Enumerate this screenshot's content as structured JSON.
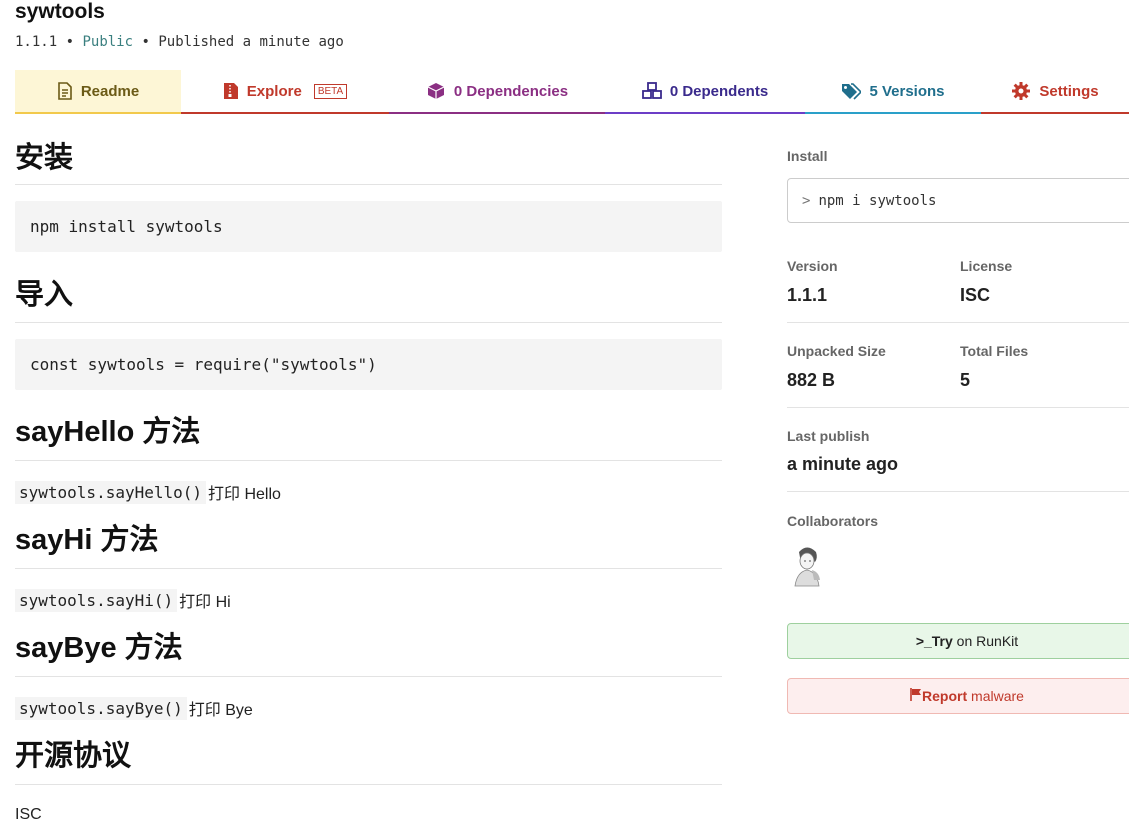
{
  "package": {
    "name": "sywtools",
    "version": "1.1.1",
    "visibility": "Public",
    "published": "Published a minute ago",
    "separator": "•"
  },
  "tabs": [
    {
      "label": "Readme",
      "icon": "readme-icon"
    },
    {
      "label": "Explore",
      "badge": "BETA",
      "icon": "explore-icon"
    },
    {
      "label": "0 Dependencies",
      "icon": "box-icon"
    },
    {
      "label": "0 Dependents",
      "icon": "boxes-icon"
    },
    {
      "label": "5 Versions",
      "icon": "tags-icon"
    },
    {
      "label": "Settings",
      "icon": "gear-icon"
    }
  ],
  "readme": {
    "sections": [
      {
        "heading": "安装",
        "code": "npm install sywtools"
      },
      {
        "heading": "导入",
        "code": "const sywtools = require(\"sywtools\")"
      },
      {
        "heading_latin": "sayHello",
        "heading_cjk": "方法",
        "code": "sywtools.sayHello()",
        "text": "打印 Hello"
      },
      {
        "heading_latin": "sayHi",
        "heading_cjk": "方法",
        "code": "sywtools.sayHi()",
        "text": "打印 Hi"
      },
      {
        "heading_latin": "sayBye",
        "heading_cjk": "方法",
        "code": "sywtools.sayBye()",
        "text": "打印 Bye"
      },
      {
        "heading": "开源协议",
        "text": "ISC"
      }
    ]
  },
  "sidebar": {
    "install_label": "Install",
    "install_prompt": ">",
    "install_command": "npm i sywtools",
    "version_label": "Version",
    "version_value": "1.1.1",
    "license_label": "License",
    "license_value": "ISC",
    "unpacked_label": "Unpacked Size",
    "unpacked_value": "882 B",
    "files_label": "Total Files",
    "files_value": "5",
    "last_publish_label": "Last publish",
    "last_publish_value": "a minute ago",
    "collaborators_label": "Collaborators",
    "runkit_prefix": ">_",
    "runkit_bold": "Try",
    "runkit_rest": " on RunKit",
    "report_label": "Report",
    "report_rest": " malware"
  },
  "colors": {
    "readme_tab_bg": "#fdf6d6",
    "readme_tab_border": "#f2c94c",
    "explore": "#c0392b",
    "dependencies": "#8b2f83",
    "dependents": "#3a2a8c",
    "versions": "#1f6e8c",
    "settings": "#c0392b",
    "runkit_bg": "#e8f7e8",
    "report_bg": "#fdeeee"
  }
}
